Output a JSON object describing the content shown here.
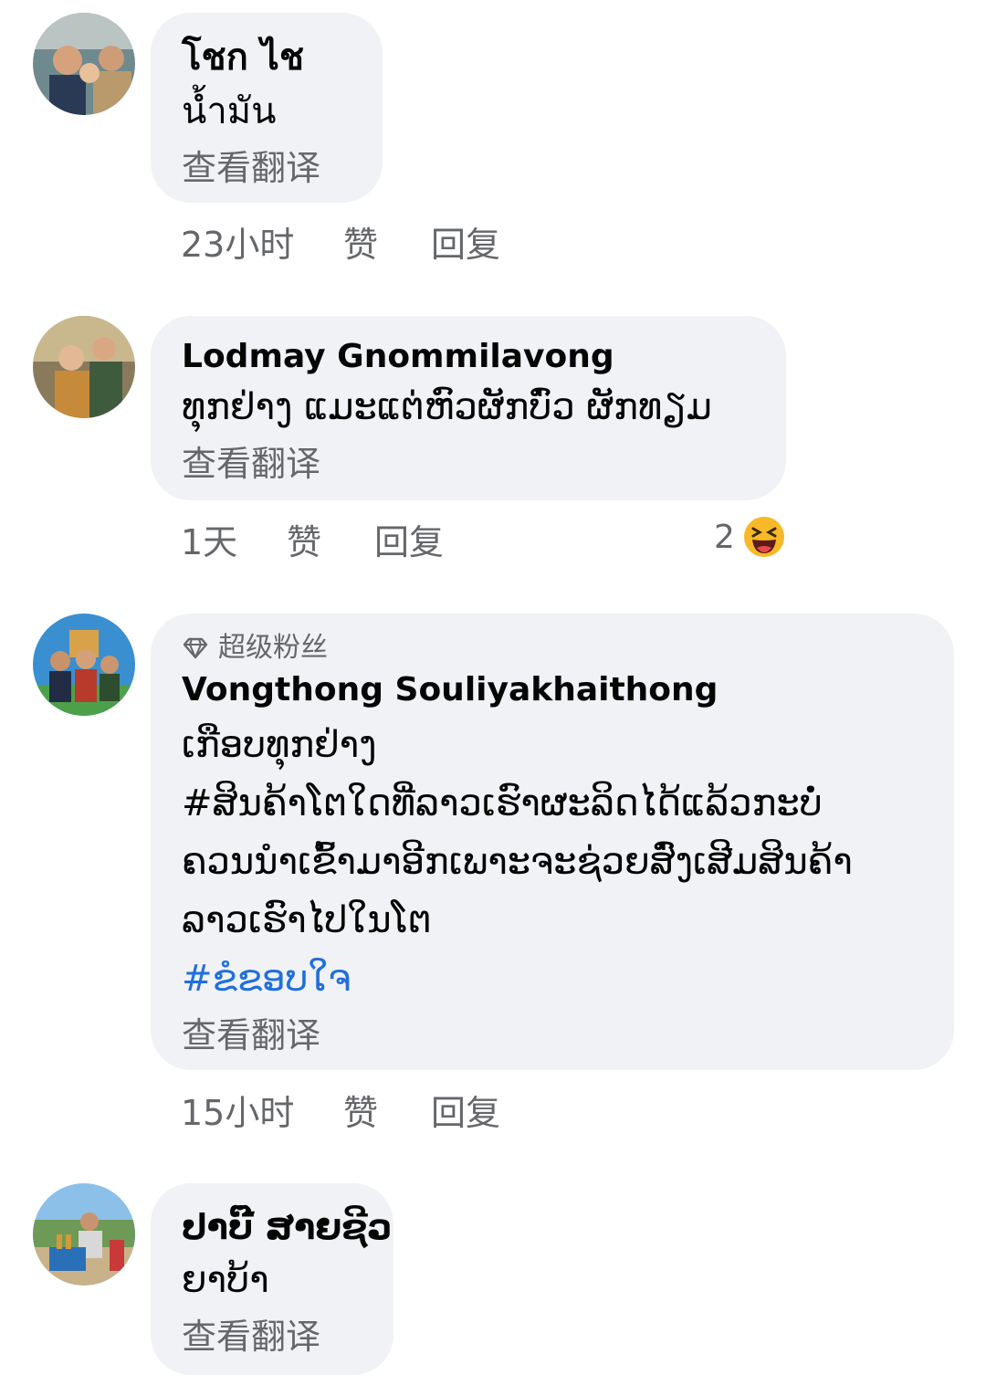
{
  "comments": [
    {
      "author": "โชก ไช",
      "lines": [
        "น้ำมัน"
      ],
      "translate": "查看翻译",
      "time": "23小时",
      "like": "赞",
      "reply": "回复"
    },
    {
      "author": "Lodmay Gnommilavong",
      "lines": [
        "ທຸກຢ່າງ ແມະແຕ່ຫົວຜັກບົ່ວ ຜັກທຽມ"
      ],
      "translate": "查看翻译",
      "time": "1天",
      "like": "赞",
      "reply": "回复",
      "reaction_count": "2",
      "reaction_icon": "laughing-emoji-icon"
    },
    {
      "badge": "超级粉丝",
      "badge_icon": "diamond-icon",
      "author": "Vongthong Souliyakhaithong",
      "lines": [
        "ເກືອບທຸກຢ່າງ",
        "#ສິນຄ້າໂຕໃດທີ່ລາວເຮົາຜະລິດໄດ້ແລ້ວກະບໍ່",
        "ຄວນນຳເຂົ້າມາອີກເພາະຈະຊ່ວຍສົ່ງເສີມສິນຄ້າ",
        "ລາວເຮົາໄປໃນໂຕ"
      ],
      "hashtag": "#ຂໍຂອບໃຈ",
      "translate": "查看翻译",
      "time": "15小时",
      "like": "赞",
      "reply": "回复"
    },
    {
      "author": "ປາບີ໊ ສາຍຊີວ",
      "lines": [
        "ຍາບ້າ"
      ],
      "translate": "查看翻译"
    }
  ],
  "colors": {
    "bubble": "#f0f2f5",
    "secondary_text": "#65676b",
    "hashtag": "#216fdb"
  }
}
